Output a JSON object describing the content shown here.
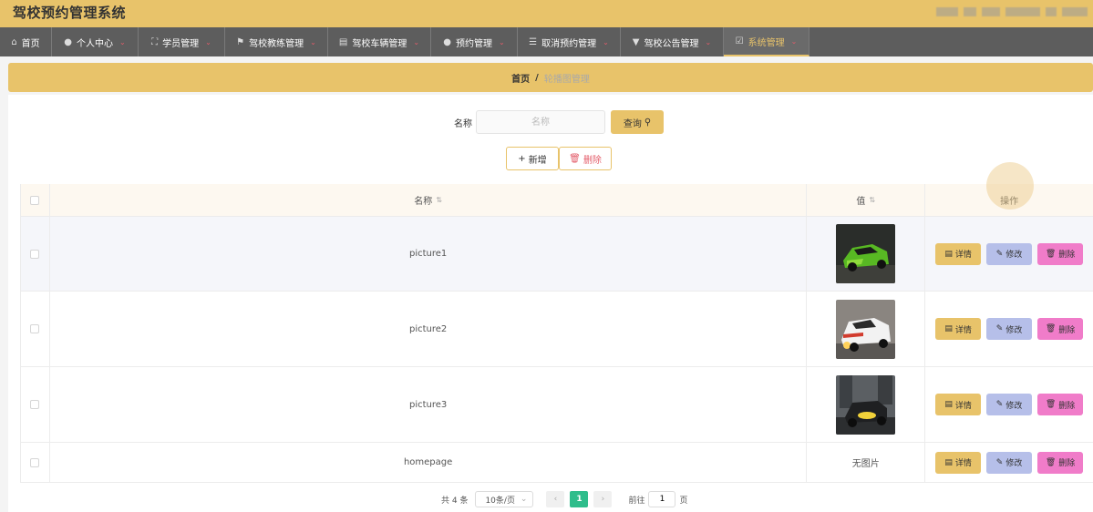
{
  "app": {
    "title": "驾校预约管理系统"
  },
  "nav": {
    "items": [
      {
        "label": "首页",
        "icon": "home-icon",
        "glyph": "⌂"
      },
      {
        "label": "个人中心",
        "icon": "user-icon",
        "glyph": "👤"
      },
      {
        "label": "学员管理",
        "icon": "expand-icon",
        "glyph": "⛶"
      },
      {
        "label": "驾校教练管理",
        "icon": "flag-icon",
        "glyph": "⚑"
      },
      {
        "label": "驾校车辆管理",
        "icon": "clipboard-icon",
        "glyph": "▤"
      },
      {
        "label": "预约管理",
        "icon": "location-icon",
        "glyph": "●"
      },
      {
        "label": "取消预约管理",
        "icon": "list-icon",
        "glyph": "☰"
      },
      {
        "label": "驾校公告管理",
        "icon": "trophy-icon",
        "glyph": "▼"
      },
      {
        "label": "系统管理",
        "icon": "checkbox-icon",
        "glyph": "☑"
      }
    ],
    "active_index": 8
  },
  "breadcrumb": {
    "home": "首页",
    "separator": "/",
    "current": "轮播图管理"
  },
  "search": {
    "label": "名称",
    "placeholder": "名称",
    "button": "查询"
  },
  "actions": {
    "add": "新增",
    "delete": "删除"
  },
  "table": {
    "headers": {
      "name": "名称",
      "value": "值",
      "operation": "操作"
    },
    "rows": [
      {
        "name": "picture1",
        "value_type": "image",
        "image": "green-race-car"
      },
      {
        "name": "picture2",
        "value_type": "image",
        "image": "white-rally-car"
      },
      {
        "name": "picture3",
        "value_type": "image",
        "image": "yellow-sports-car"
      },
      {
        "name": "homepage",
        "value_type": "text",
        "value_text": "无图片"
      }
    ],
    "row_buttons": {
      "detail": "详情",
      "edit": "修改",
      "delete": "删除"
    }
  },
  "pagination": {
    "total": "共 4 条",
    "page_size": "10条/页",
    "current_page": "1",
    "goto_label": "前往",
    "goto_value": "1",
    "page_suffix": "页"
  },
  "colors": {
    "accent": "#e8c36a",
    "nav_bg": "#5d5d5d",
    "edit": "#b6bfe9",
    "delete": "#f07cc9",
    "page_active": "#2fbd8b"
  }
}
